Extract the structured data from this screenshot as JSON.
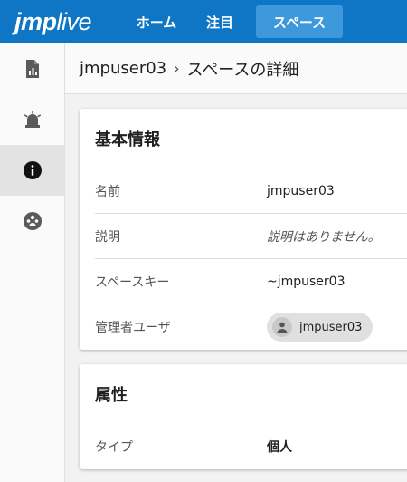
{
  "header": {
    "logo_left": "jmp",
    "logo_right": "live",
    "tabs": [
      {
        "label": "ホーム"
      },
      {
        "label": "注目"
      },
      {
        "label": "スペース"
      }
    ]
  },
  "sidebar": {
    "items": [
      {
        "icon": "report-icon"
      },
      {
        "icon": "alert-icon"
      },
      {
        "icon": "info-icon"
      },
      {
        "icon": "group-icon"
      }
    ]
  },
  "breadcrumb": {
    "user": "jmpuser03",
    "separator": "›",
    "page": "スペースの詳細"
  },
  "basic_info": {
    "title": "基本情報",
    "rows": [
      {
        "label": "名前",
        "value": "jmpuser03"
      },
      {
        "label": "説明",
        "value": "説明はありません。"
      },
      {
        "label": "スペースキー",
        "value": "~jmpuser03"
      },
      {
        "label": "管理者ユーザ",
        "value": "jmpuser03"
      }
    ]
  },
  "attributes": {
    "title": "属性",
    "rows": [
      {
        "label": "タイプ",
        "value": "個人"
      }
    ]
  },
  "colors": {
    "header_bg": "#0f76c5",
    "active_tab_bg": "#3e99dc",
    "sidebar_active_bg": "#e3e3e3"
  }
}
